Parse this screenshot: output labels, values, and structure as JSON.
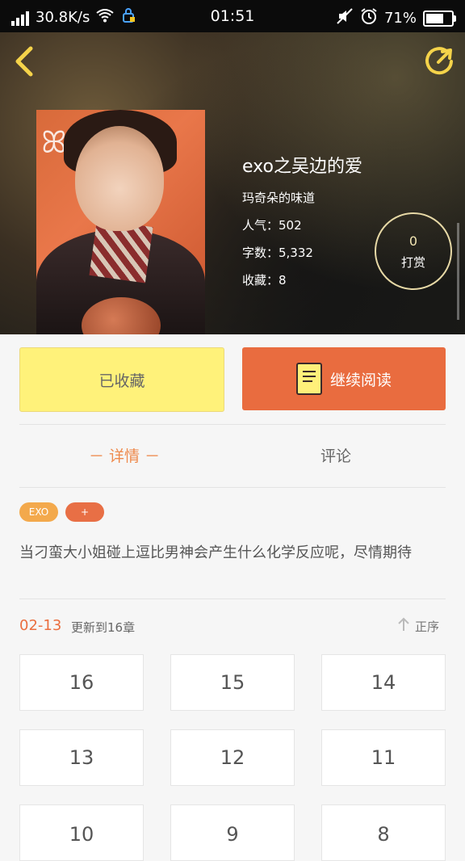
{
  "status_bar": {
    "speed": "30.8K/s",
    "time": "01:51",
    "battery_percent": "71%",
    "battery_level": 0.71
  },
  "header": {
    "back_icon": "chevron-left-icon",
    "share_icon": "share-refresh-icon"
  },
  "book": {
    "title": "exo之吴边的爱",
    "author": "玛奇朵的味道",
    "popularity_label": "人气：502",
    "words_label": "字数：5,332",
    "collect_label": "收藏：8"
  },
  "tip": {
    "count": "0",
    "label": "打赏"
  },
  "actions": {
    "collected_label": "已收藏",
    "continue_label": "继续阅读"
  },
  "tabs": {
    "detail": "－ 详情 －",
    "comment": "评论"
  },
  "tags": [
    "EXO",
    "+"
  ],
  "description": "当刁蛮大小姐碰上逗比男神会产生什么化学反应呢，尽情期待",
  "update": {
    "date": "02-13",
    "text": "更新到16章",
    "sort_label": "正序"
  },
  "chapters": [
    "16",
    "15",
    "14",
    "13",
    "12",
    "11",
    "10",
    "9",
    "8"
  ],
  "colors": {
    "accent_orange": "#e96c3f",
    "accent_yellow": "#fff27a",
    "tag_orange": "#f3a94c"
  }
}
